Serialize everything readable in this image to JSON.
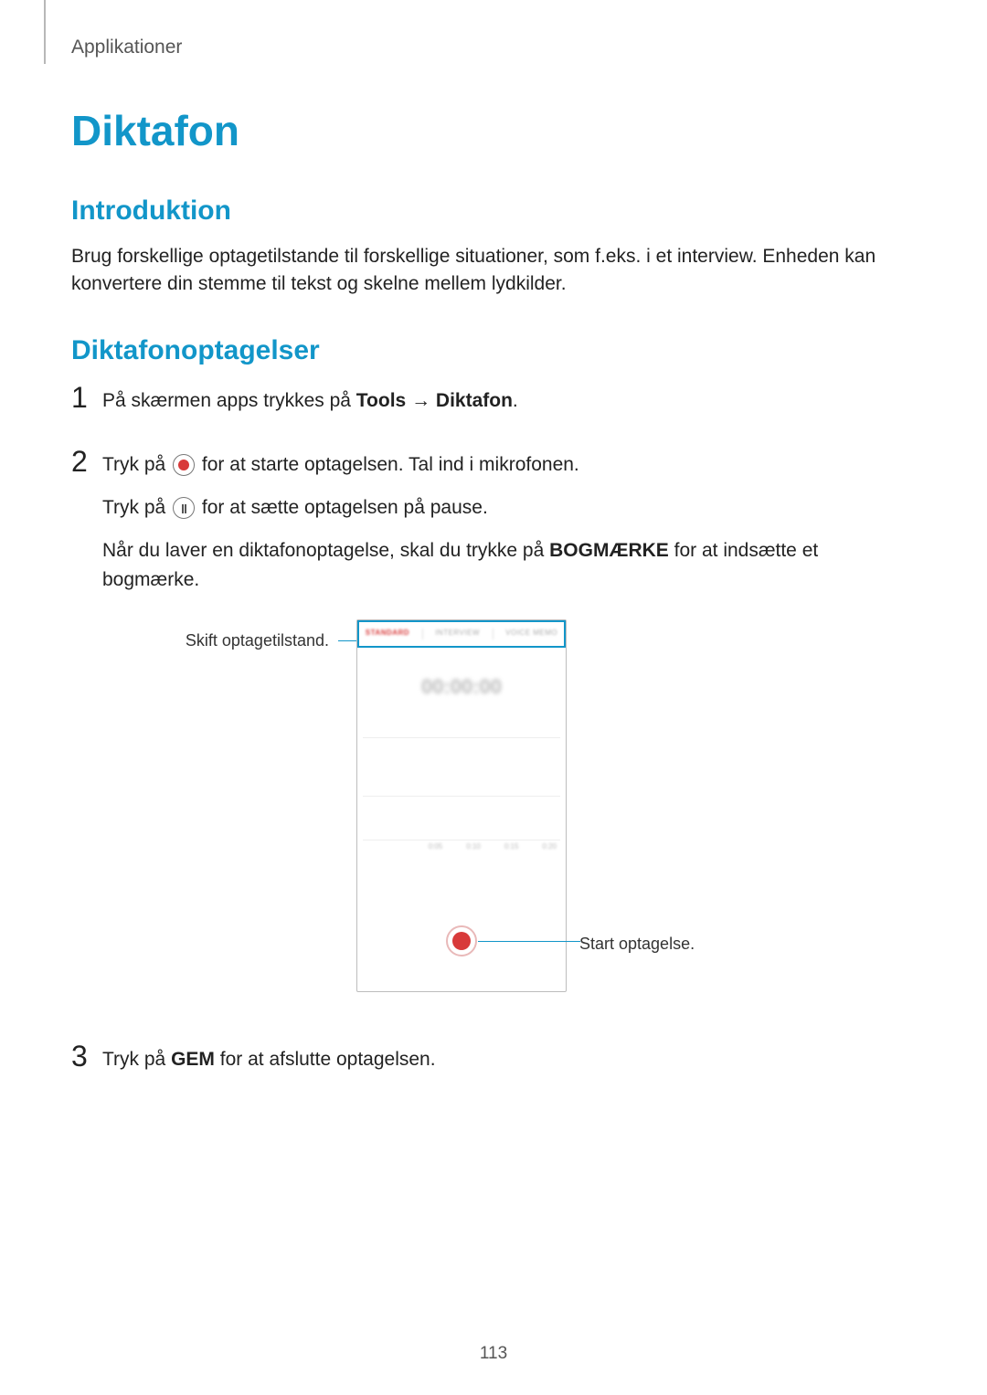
{
  "breadcrumb": "Applikationer",
  "title": "Diktafon",
  "sections": {
    "intro": {
      "heading": "Introduktion",
      "body": "Brug forskellige optagetilstande til forskellige situationer, som f.eks. i et interview. Enheden kan konvertere din stemme til tekst og skelne mellem lydkilder."
    },
    "recordings": {
      "heading": "Diktafonoptagelser",
      "steps": [
        {
          "num": "1",
          "line1_pre": "På skærmen apps trykkes på ",
          "line1_bold1": "Tools",
          "line1_arrow": " → ",
          "line1_bold2": "Diktafon",
          "line1_post": "."
        },
        {
          "num": "2",
          "line1_pre": "Tryk på ",
          "line1_post": " for at starte optagelsen. Tal ind i mikrofonen.",
          "line2_pre": "Tryk på ",
          "line2_post": " for at sætte optagelsen på pause.",
          "line3_pre": "Når du laver en diktafonoptagelse, skal du trykke på ",
          "line3_bold": "BOGMÆRKE",
          "line3_post": " for at indsætte et bogmærke."
        },
        {
          "num": "3",
          "line1_pre": "Tryk på ",
          "line1_bold": "GEM",
          "line1_post": " for at afslutte optagelsen."
        }
      ]
    }
  },
  "figure": {
    "callout_left": "Skift optagetilstand.",
    "callout_right": "Start optagelse.",
    "tabs": {
      "standard": "STANDARD",
      "interview": "INTERVIEW",
      "voicememo": "VOICE MEMO"
    },
    "timer": "00:00:00",
    "ticks": [
      "0:05",
      "0:10",
      "0:15",
      "0:20"
    ]
  },
  "page_number": "113"
}
